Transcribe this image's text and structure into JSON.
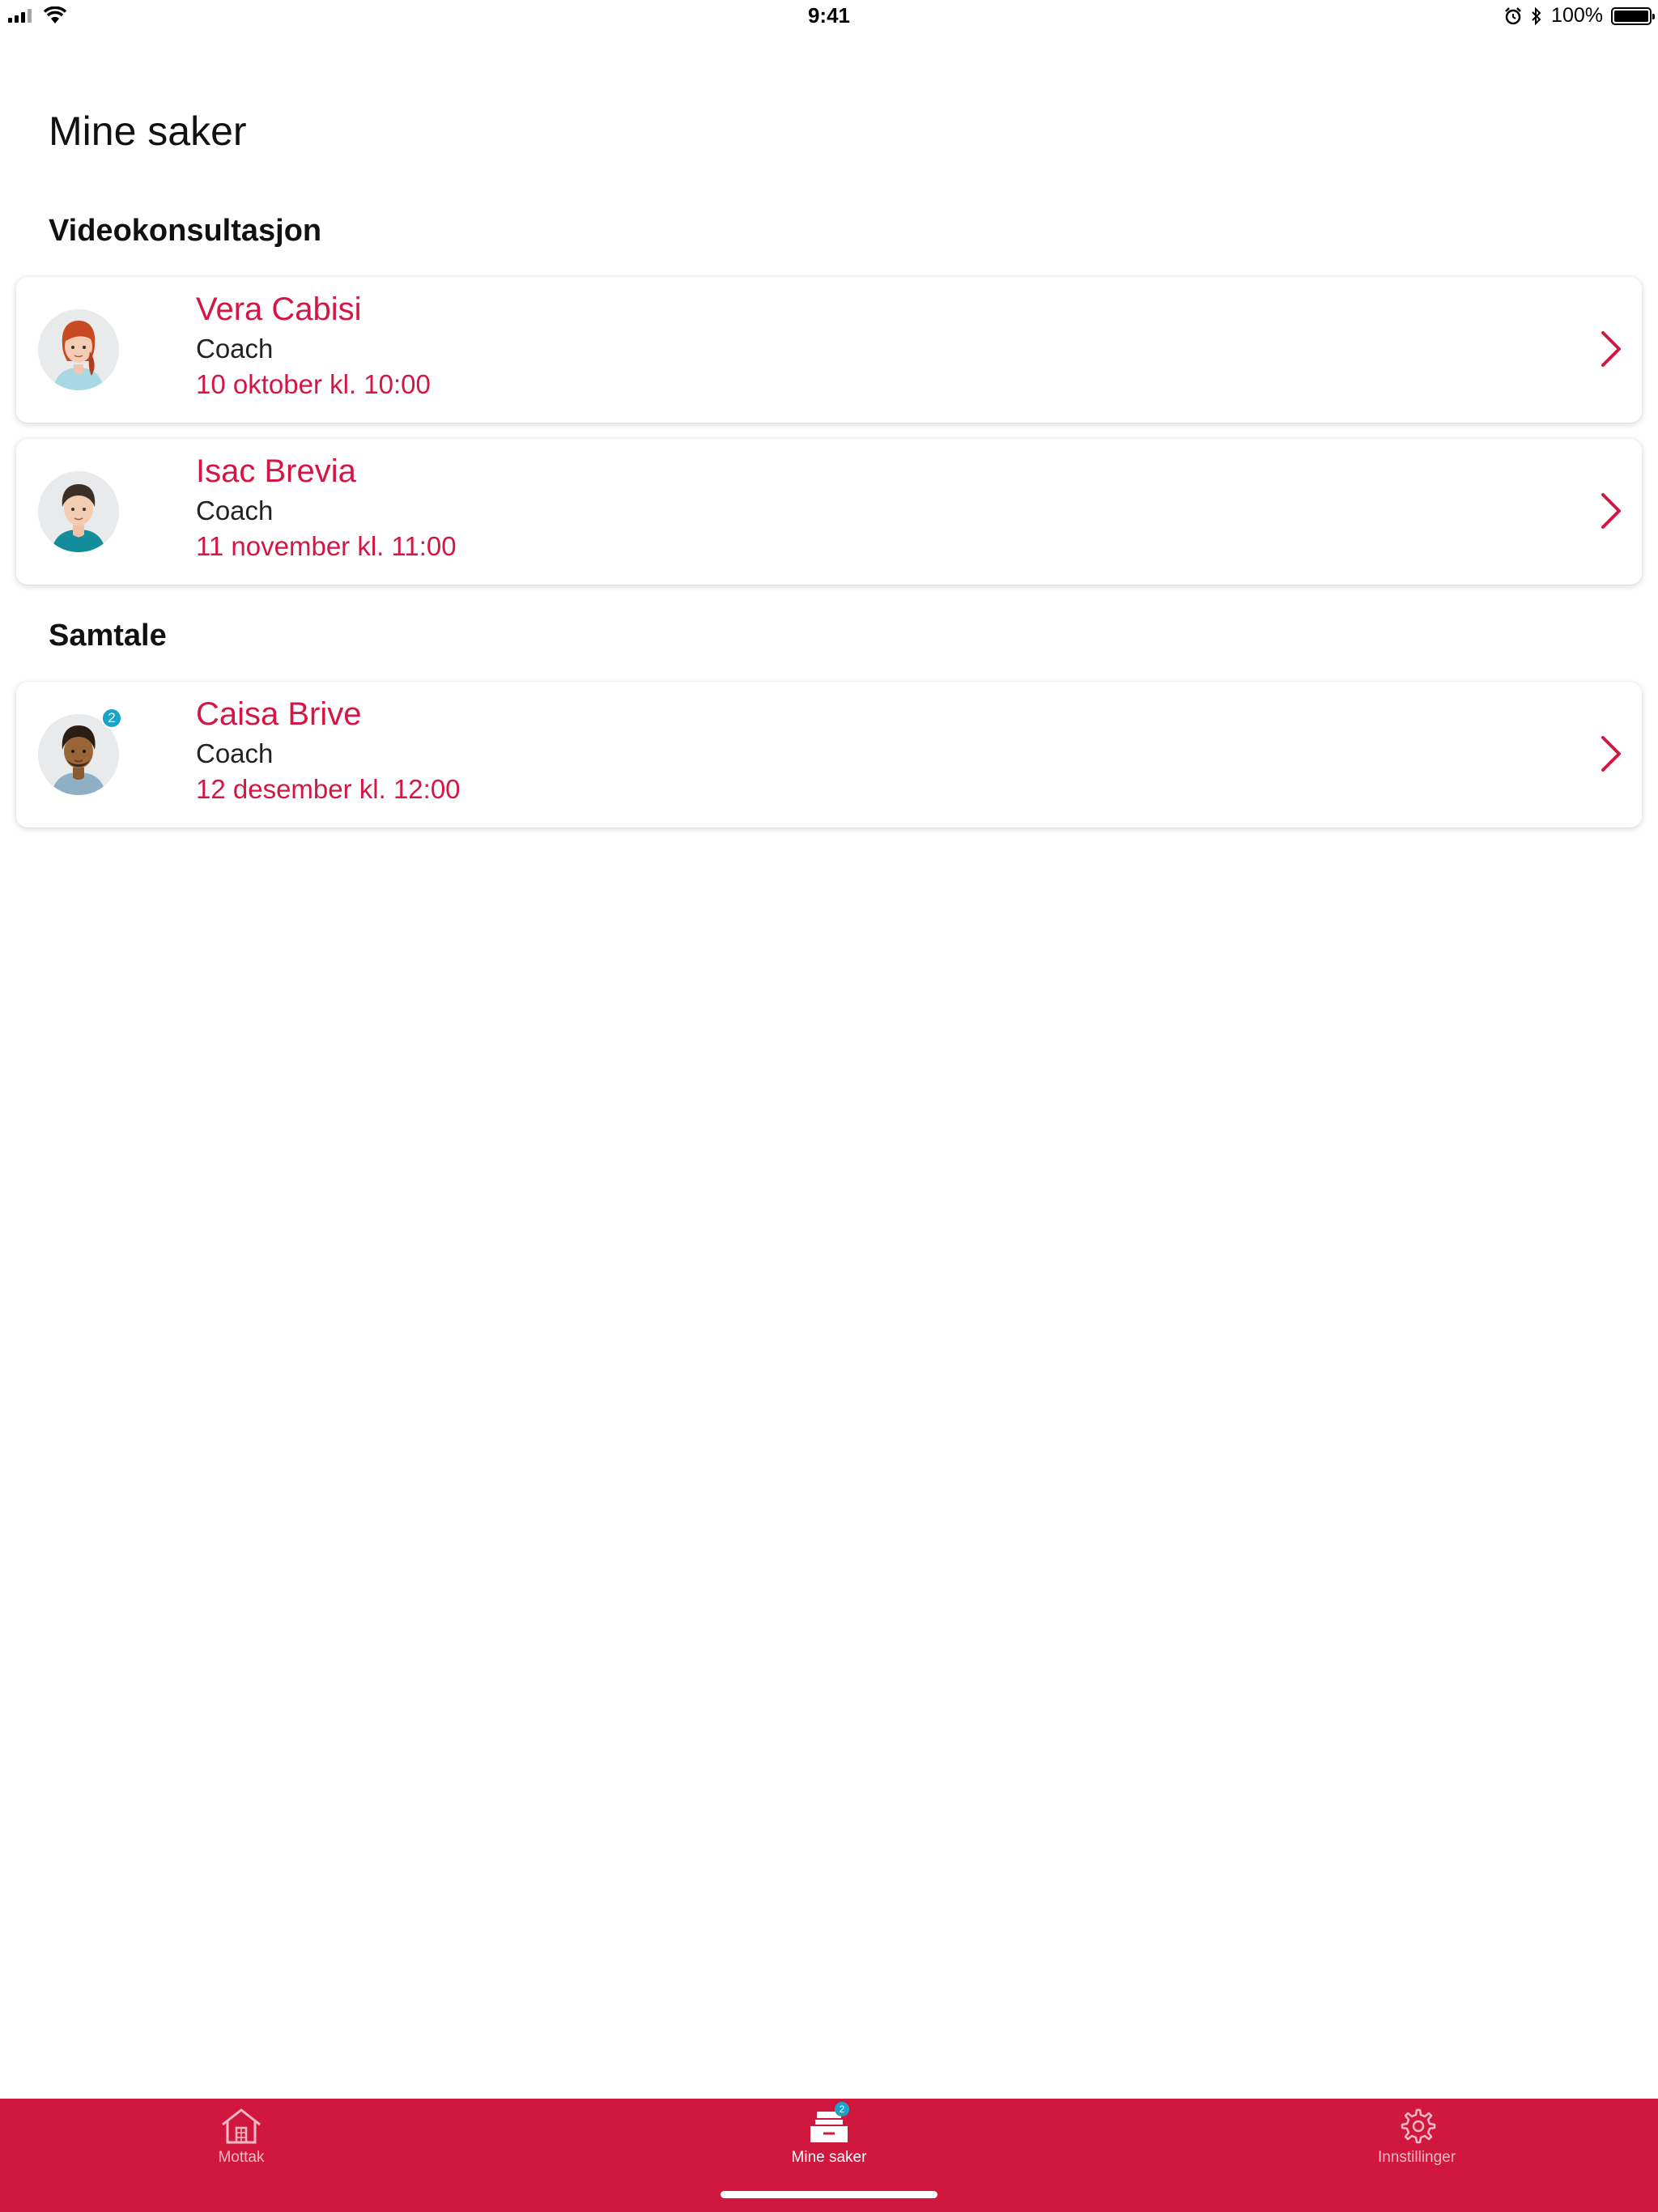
{
  "status_bar": {
    "time": "9:41",
    "battery": "100%",
    "icons": [
      "signal-icon",
      "wifi-icon",
      "alarm-icon",
      "bluetooth-icon",
      "battery-icon"
    ]
  },
  "page": {
    "title": "Mine saker"
  },
  "sections": [
    {
      "title": "Videokonsultasjon",
      "items": [
        {
          "name": "Vera Cabisi",
          "role": "Coach",
          "date": "10 oktober kl. 10:00"
        },
        {
          "name": "Isac Brevia",
          "role": "Coach",
          "date": "11 november kl. 11:00"
        }
      ]
    },
    {
      "title": "Samtale",
      "items": [
        {
          "name": "Caisa Brive",
          "role": "Coach",
          "date": "12 desember kl. 12:00",
          "badge": "2"
        }
      ]
    }
  ],
  "tab_bar": {
    "tabs": [
      {
        "label": "Mottak",
        "icon": "house-icon"
      },
      {
        "label": "Mine saker",
        "icon": "inbox-tray-icon",
        "badge": "2",
        "active": true
      },
      {
        "label": "Innstillinger",
        "icon": "gear-icon"
      }
    ]
  },
  "colors": {
    "accent": "#d41645",
    "tab_bar": "#d0183f",
    "badge": "#1aa3c8"
  }
}
